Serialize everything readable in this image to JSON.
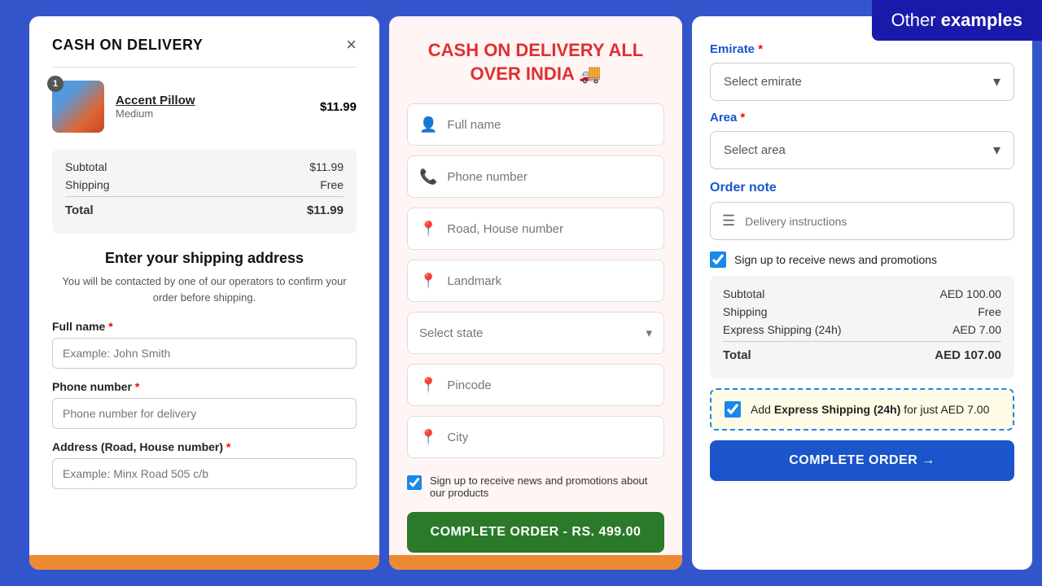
{
  "banner": {
    "text_light": "Other ",
    "text_bold": "examples"
  },
  "left_panel": {
    "title": "CASH ON DELIVERY",
    "close_label": "×",
    "product": {
      "name": "Accent Pillow",
      "variant": "Medium",
      "price": "$11.99",
      "badge": "1"
    },
    "summary": {
      "subtotal_label": "Subtotal",
      "subtotal_value": "$11.99",
      "shipping_label": "Shipping",
      "shipping_value": "Free",
      "total_label": "Total",
      "total_value": "$11.99"
    },
    "form_section_title": "Enter your shipping address",
    "form_section_desc": "You will be contacted by one of our operators to confirm your order before shipping.",
    "fields": [
      {
        "label": "Full name",
        "required": true,
        "placeholder": "Example: John Smith"
      },
      {
        "label": "Phone number",
        "required": true,
        "placeholder": "Phone number for delivery"
      },
      {
        "label": "Address (Road, House number)",
        "required": true,
        "placeholder": "Example: Minx Road 505 c/b"
      }
    ]
  },
  "middle_panel": {
    "title": "CASH ON DELIVERY ALL OVER INDIA 🚚",
    "inputs": [
      {
        "icon": "👤",
        "placeholder": "Full name",
        "type": "text"
      },
      {
        "icon": "📞",
        "placeholder": "Phone number",
        "type": "tel"
      },
      {
        "icon": "📍",
        "placeholder": "Road, House number",
        "type": "text"
      },
      {
        "icon": "📍",
        "placeholder": "Landmark",
        "type": "text"
      }
    ],
    "state_select": "Select state",
    "inputs2": [
      {
        "icon": "📍",
        "placeholder": "Pincode",
        "type": "text"
      },
      {
        "icon": "📍",
        "placeholder": "City",
        "type": "text"
      }
    ],
    "signup_label": "Sign up to receive news and promotions about our products",
    "signup_checked": true,
    "complete_btn": "COMPLETE ORDER - Rs. 499.00"
  },
  "right_panel": {
    "emirate_label": "Emirate",
    "emirate_required": true,
    "emirate_placeholder": "Select emirate",
    "area_label": "Area",
    "area_required": true,
    "area_placeholder": "Select area",
    "order_note_label": "Order note",
    "delivery_placeholder": "Delivery instructions",
    "signup_label": "Sign up to receive news and promotions",
    "signup_checked": true,
    "summary": {
      "subtotal_label": "Subtotal",
      "subtotal_value": "AED 100.00",
      "shipping_label": "Shipping",
      "shipping_value": "Free",
      "express_label": "Express Shipping (24h)",
      "express_value": "AED 7.00",
      "total_label": "Total",
      "total_value": "AED 107.00"
    },
    "express_box": {
      "label_prefix": "Add ",
      "label_highlight": "Express Shipping (24h)",
      "label_suffix": " for just AED 7.00",
      "checked": true
    },
    "complete_btn": "COMPLETE ORDER →"
  }
}
